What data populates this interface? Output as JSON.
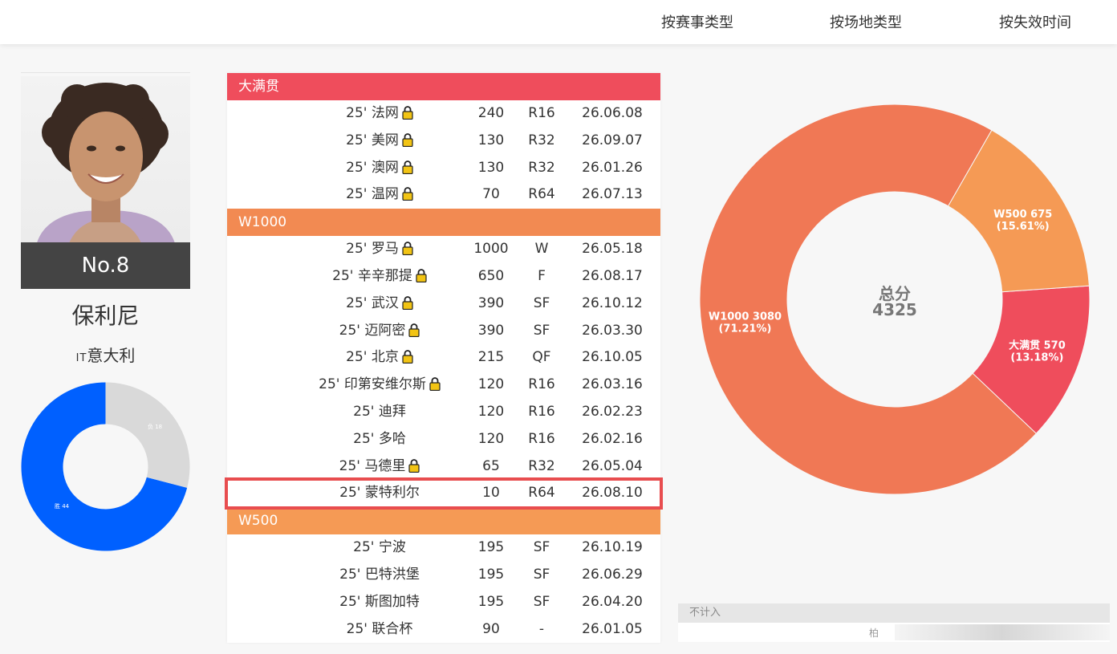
{
  "nav": {
    "tab_event_type": "按赛事类型",
    "tab_surface_type": "按场地类型",
    "tab_expiry_time": "按失效时间"
  },
  "player": {
    "rank_label": "No.8",
    "name": "保利尼",
    "country_code": "IT",
    "country_name": "意大利"
  },
  "winloss_chart": {
    "wins_label": "胜 44",
    "losses_label": "负 18",
    "wins": 44,
    "losses": 18,
    "win_color": "#0060ff",
    "loss_color": "#d9d9d9"
  },
  "groups": [
    {
      "name": "大满贯",
      "color": "#ef4d5c",
      "rows": [
        {
          "event": "25' 法网",
          "points": "240",
          "round": "R16",
          "expires": "26.06.08",
          "locked": true
        },
        {
          "event": "25' 美网",
          "points": "130",
          "round": "R32",
          "expires": "26.09.07",
          "locked": true
        },
        {
          "event": "25' 澳网",
          "points": "130",
          "round": "R32",
          "expires": "26.01.26",
          "locked": true
        },
        {
          "event": "25' 温网",
          "points": "70",
          "round": "R64",
          "expires": "26.07.13",
          "locked": true
        }
      ]
    },
    {
      "name": "W1000",
      "color": "#f28a52",
      "rows": [
        {
          "event": "25' 罗马",
          "points": "1000",
          "round": "W",
          "expires": "26.05.18",
          "locked": true
        },
        {
          "event": "25' 辛辛那提",
          "points": "650",
          "round": "F",
          "expires": "26.08.17",
          "locked": true
        },
        {
          "event": "25' 武汉",
          "points": "390",
          "round": "SF",
          "expires": "26.10.12",
          "locked": true
        },
        {
          "event": "25' 迈阿密",
          "points": "390",
          "round": "SF",
          "expires": "26.03.30",
          "locked": true
        },
        {
          "event": "25' 北京",
          "points": "215",
          "round": "QF",
          "expires": "26.10.05",
          "locked": true
        },
        {
          "event": "25' 印第安维尔斯",
          "points": "120",
          "round": "R16",
          "expires": "26.03.16",
          "locked": true
        },
        {
          "event": "25' 迪拜",
          "points": "120",
          "round": "R16",
          "expires": "26.02.23",
          "locked": false
        },
        {
          "event": "25' 多哈",
          "points": "120",
          "round": "R16",
          "expires": "26.02.16",
          "locked": false
        },
        {
          "event": "25' 马德里",
          "points": "65",
          "round": "R32",
          "expires": "26.05.04",
          "locked": true
        },
        {
          "event": "25' 蒙特利尔",
          "points": "10",
          "round": "R64",
          "expires": "26.08.10",
          "locked": false,
          "highlighted": true
        }
      ]
    },
    {
      "name": "W500",
      "color": "#f59a55",
      "rows": [
        {
          "event": "25' 宁波",
          "points": "195",
          "round": "SF",
          "expires": "26.10.19",
          "locked": false
        },
        {
          "event": "25' 巴特洪堡",
          "points": "195",
          "round": "SF",
          "expires": "26.06.29",
          "locked": false
        },
        {
          "event": "25' 斯图加特",
          "points": "195",
          "round": "SF",
          "expires": "26.04.20",
          "locked": false
        },
        {
          "event": "25' 联合杯",
          "points": "90",
          "round": "-",
          "expires": "26.01.05",
          "locked": false
        }
      ]
    }
  ],
  "chart_data": {
    "type": "pie",
    "title": "",
    "center_label": "总分",
    "center_value": "4325",
    "slices": [
      {
        "name": "W1000",
        "value": 3080,
        "pct": "71.21%",
        "color": "#f07855"
      },
      {
        "name": "W500",
        "value": 675,
        "pct": "15.61%",
        "color": "#f59a55"
      },
      {
        "name": "大满贯",
        "value": 570,
        "pct": "13.18%",
        "color": "#ef4d5c"
      }
    ],
    "legend": "none"
  },
  "not_counted": {
    "header": "不计入",
    "body_text": "柏"
  }
}
